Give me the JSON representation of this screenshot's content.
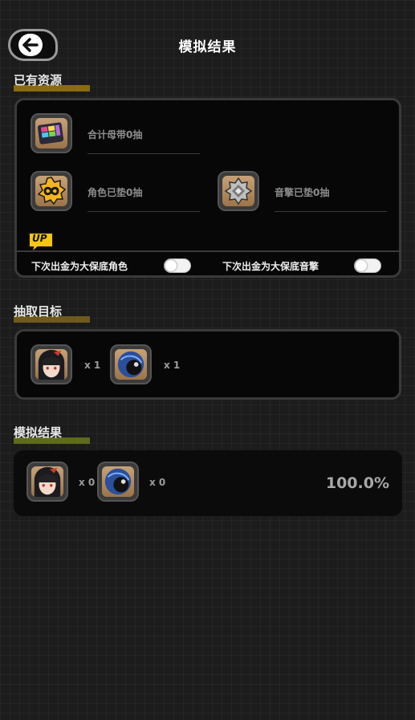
{
  "header": {
    "title": "模拟结果"
  },
  "sections": {
    "resources": {
      "title": "已有资源",
      "underline_color": "#8a6a12"
    },
    "targets": {
      "title": "抽取目标",
      "underline_color": "#6e5a1e"
    },
    "results": {
      "title": "模拟结果",
      "underline_color": "#5e6a1c"
    }
  },
  "resources": {
    "tapes": {
      "label": "合计母带0抽",
      "icon": "tape-icon"
    },
    "agent_pity": {
      "label": "角色已垫0抽",
      "icon": "infinity-badge-icon"
    },
    "engine_pity": {
      "label": "音擎已垫0抽",
      "icon": "engine-badge-icon"
    },
    "up_badge": "UP",
    "toggles": [
      {
        "label": "下次出金为大保底角色",
        "on": false
      },
      {
        "label": "下次出金为大保底音擎",
        "on": false
      }
    ]
  },
  "targets": [
    {
      "icon": "agent-portrait-icon",
      "qty": "x 1"
    },
    {
      "icon": "w-engine-orb-icon",
      "qty": "x 1"
    }
  ],
  "results": {
    "items": [
      {
        "icon": "agent-portrait-icon",
        "qty": "x 0"
      },
      {
        "icon": "w-engine-orb-icon",
        "qty": "x 0"
      }
    ],
    "probability": "100.0%"
  },
  "colors": {
    "background": "#1c1c1c",
    "panel": "#070707",
    "panel_border": "#3a3a3a",
    "icon_frame": "#c7a178"
  }
}
